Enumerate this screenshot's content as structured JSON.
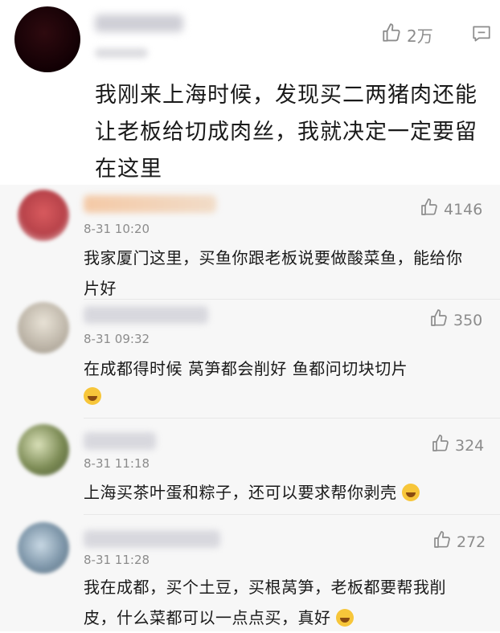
{
  "post": {
    "likes": "2万",
    "text": "我刚来上海时候，发现买二两猪肉还能让老板给切成肉丝，我就决定一定要留在这里"
  },
  "comments": [
    {
      "time": "8-31 10:20",
      "likes": "4146",
      "text": "我家厦门这里，买鱼你跟老板说要做酸菜鱼，能给你片好"
    },
    {
      "time": "8-31 09:32",
      "likes": "350",
      "text": "在成都得时候 莴笋都会削好 鱼都问切块切片"
    },
    {
      "time": "8-31 11:18",
      "likes": "324",
      "text": "上海买茶叶蛋和粽子，还可以要求帮你剥壳"
    },
    {
      "time": "8-31 11:28",
      "likes": "272",
      "text": "我在成都，买个土豆，买根莴笋，老板都要帮我削皮，什么菜都可以一点点买，真好"
    }
  ],
  "icons": [
    "thumbs-up-icon",
    "reply-icon",
    "emoji-icon"
  ],
  "colors": {
    "meta_gray": "#8c8c8c",
    "comment_bg": "#f7f7f7"
  }
}
